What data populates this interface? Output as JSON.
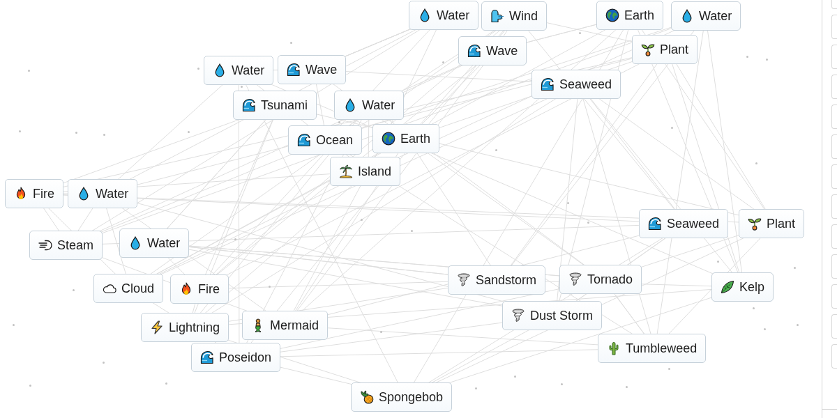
{
  "canvas": {
    "elements": [
      {
        "label": "Water",
        "kind": "droplet"
      },
      {
        "label": "Wind",
        "kind": "wind"
      },
      {
        "label": "Earth",
        "kind": "globe"
      },
      {
        "label": "Water",
        "kind": "droplet"
      },
      {
        "label": "Wave",
        "kind": "wave"
      },
      {
        "label": "Plant",
        "kind": "seedling"
      },
      {
        "label": "Water",
        "kind": "droplet"
      },
      {
        "label": "Wave",
        "kind": "wave"
      },
      {
        "label": "Seaweed",
        "kind": "wave"
      },
      {
        "label": "Tsunami",
        "kind": "wave"
      },
      {
        "label": "Water",
        "kind": "droplet"
      },
      {
        "label": "Ocean",
        "kind": "wave"
      },
      {
        "label": "Earth",
        "kind": "globe"
      },
      {
        "label": "Island",
        "kind": "palm"
      },
      {
        "label": "Fire",
        "kind": "flame"
      },
      {
        "label": "Water",
        "kind": "droplet"
      },
      {
        "label": "Seaweed",
        "kind": "wave"
      },
      {
        "label": "Plant",
        "kind": "seedling"
      },
      {
        "label": "Steam",
        "kind": "puff"
      },
      {
        "label": "Water",
        "kind": "droplet"
      },
      {
        "label": "Cloud",
        "kind": "cloud"
      },
      {
        "label": "Fire",
        "kind": "flame"
      },
      {
        "label": "Sandstorm",
        "kind": "tornado"
      },
      {
        "label": "Tornado",
        "kind": "tornado"
      },
      {
        "label": "Kelp",
        "kind": "leaf"
      },
      {
        "label": "Dust Storm",
        "kind": "tornado"
      },
      {
        "label": "Lightning",
        "kind": "bolt"
      },
      {
        "label": "Mermaid",
        "kind": "mermaid"
      },
      {
        "label": "Tumbleweed",
        "kind": "cactus"
      },
      {
        "label": "Poseidon",
        "kind": "wave"
      },
      {
        "label": "Spongebob",
        "kind": "pineapple"
      }
    ]
  }
}
